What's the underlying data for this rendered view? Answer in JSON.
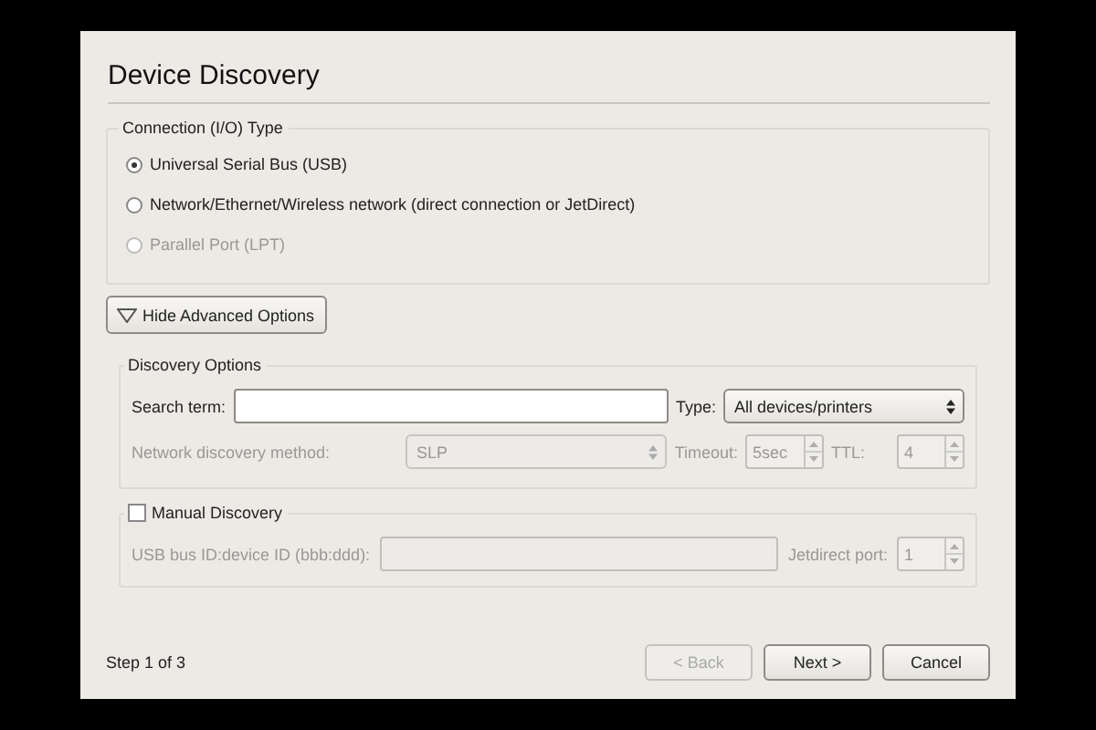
{
  "window": {
    "title": "Device Discovery"
  },
  "connection_type": {
    "label": "Connection (I/O) Type",
    "options": [
      {
        "label": "Universal Serial Bus (USB)",
        "selected": true,
        "disabled": false
      },
      {
        "label": "Network/Ethernet/Wireless network (direct connection or JetDirect)",
        "selected": false,
        "disabled": false
      },
      {
        "label": "Parallel Port (LPT)",
        "selected": false,
        "disabled": true
      }
    ]
  },
  "advanced_toggle": {
    "label": "Hide Advanced Options",
    "expanded": true
  },
  "discovery_options": {
    "label": "Discovery Options",
    "search": {
      "label": "Search term:"
    },
    "type": {
      "label": "Type:",
      "value": "All devices/printers"
    },
    "network_method": {
      "label": "Network discovery method:",
      "value": "SLP",
      "disabled": true
    },
    "timeout": {
      "label": "Timeout:",
      "value": "5sec",
      "disabled": true
    },
    "ttl": {
      "label": "TTL:",
      "value": "4",
      "disabled": true
    }
  },
  "manual_discovery": {
    "label": "Manual Discovery",
    "checked": false,
    "usb_id": {
      "label": "USB bus ID:device ID (bbb:ddd):",
      "disabled": true
    },
    "jetdirect_port": {
      "label": "Jetdirect port:",
      "value": "1",
      "disabled": true
    }
  },
  "footer": {
    "step": "Step 1 of 3",
    "buttons": [
      {
        "label": "< Back",
        "disabled": true
      },
      {
        "label": "Next >",
        "disabled": false
      },
      {
        "label": "Cancel",
        "disabled": false
      }
    ]
  }
}
